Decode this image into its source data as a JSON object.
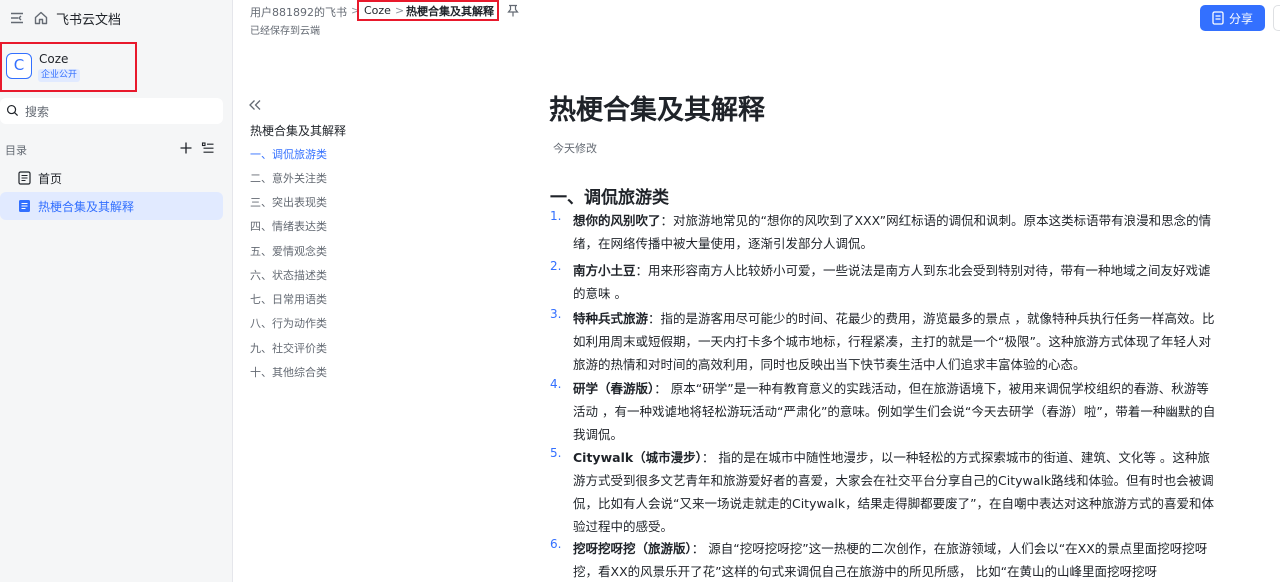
{
  "app": {
    "name": "飞书云文档"
  },
  "workspace": {
    "logo_letter": "C",
    "name": "Coze",
    "badge": "企业公开"
  },
  "search": {
    "label": "搜索"
  },
  "toc": {
    "heading": "目录"
  },
  "nav": {
    "home": "首页",
    "active": "热梗合集及其解释"
  },
  "breadcrumb": {
    "owner": "用户881892的飞书",
    "sep": ">",
    "space": "Coze",
    "doc": "热梗合集及其解释"
  },
  "status": {
    "saved": "已经保存到云端"
  },
  "header": {
    "share": "分享"
  },
  "outline": {
    "title": "热梗合集及其解释",
    "items": [
      "一、调侃旅游类",
      "二、意外关注类",
      "三、突出表现类",
      "四、情绪表达类",
      "五、爱情观念类",
      "六、状态描述类",
      "七、日常用语类",
      "八、行为动作类",
      "九、社交评价类",
      "十、其他综合类"
    ]
  },
  "doc": {
    "title": "热梗合集及其解释",
    "modified": "今天修改",
    "section1": "一、调侃旅游类",
    "items": [
      {
        "num": "1.",
        "term": "想你的风别吹了",
        "desc": "：对旅游地常见的“想你的风吹到了XXX”网红标语的调侃和讽刺。原本这类标语带有浪漫和思念的情绪，在网络传播中被大量使用，逐渐引发部分人调侃。"
      },
      {
        "num": "2.",
        "term": "南方小土豆",
        "desc": "：用来形容南方人比较娇小可爱，一些说法是南方人到东北会受到特别对待，带有一种地域之间友好戏谑的意味 。"
      },
      {
        "num": "3.",
        "term": "特种兵式旅游",
        "desc": "：指的是游客用尽可能少的时间、花最少的费用，游览最多的景点 ，就像特种兵执行任务一样高效。比如利用周末或短假期，一天内打卡多个城市地标，行程紧凑，主打的就是一个“极限”。这种旅游方式体现了年轻人对旅游的热情和对时间的高效利用，同时也反映出当下快节奏生活中人们追求丰富体验的心态。"
      },
      {
        "num": "4.",
        "term": "研学（春游版）",
        "desc": "： 原本“研学”是一种有教育意义的实践活动，但在旅游语境下，被用来调侃学校组织的春游、秋游等活动 ，有一种戏谑地将轻松游玩活动“严肃化”的意味。例如学生们会说“今天去研学（春游）啦”，带着一种幽默的自我调侃。"
      },
      {
        "num": "5.",
        "term": "Citywalk（城市漫步）",
        "desc": "： 指的是在城市中随性地漫步，以一种轻松的方式探索城市的街道、建筑、文化等 。这种旅游方式受到很多文艺青年和旅游爱好者的喜爱，大家会在社交平台分享自己的Citywalk路线和体验。但有时也会被调侃，比如有人会说“又来一场说走就走的Citywalk，结果走得脚都要废了”，在自嘲中表达对这种旅游方式的喜爱和体验过程中的感受。"
      },
      {
        "num": "6.",
        "term": "挖呀挖呀挖（旅游版）",
        "desc": "： 源自“挖呀挖呀挖”这一热梗的二次创作，在旅游领域，人们会以“在XX的景点里面挖呀挖呀挖，看XX的风景乐开了花”这样的句式来调侃自己在旅游中的所见所感， 比如“在黄山的山峰里面挖呀挖呀"
      }
    ]
  },
  "colors": {
    "accent": "#3370ff",
    "highlight_box": "#e8192c",
    "sidebar_bg": "#f5f6f7"
  },
  "icons": [
    "sidebar-collapse-icon",
    "home-icon",
    "search-icon",
    "plus-icon",
    "list-icon",
    "doc-icon",
    "pin-icon",
    "share-doc-icon",
    "double-chevron-left-icon"
  ]
}
